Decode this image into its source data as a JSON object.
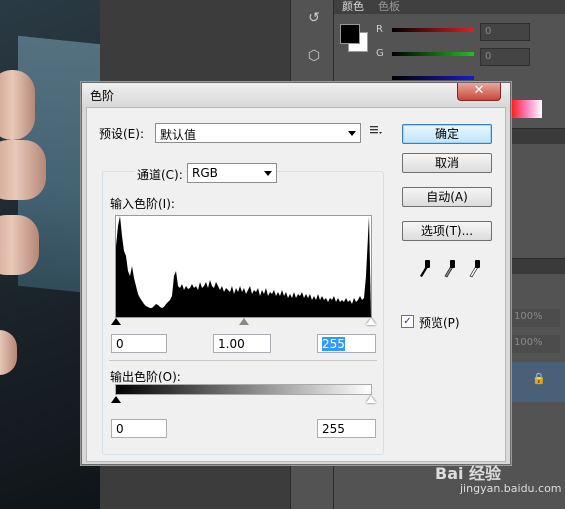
{
  "panel": {
    "tab_color": "颜色",
    "tab_swatches": "色板",
    "channels": [
      {
        "label": "R",
        "value": "0",
        "color": "#e02020"
      },
      {
        "label": "G",
        "value": "0",
        "color": "#20c020"
      },
      {
        "label": "B",
        "value": "",
        "color": "#1a1acc"
      }
    ],
    "zoom_values": [
      "100%",
      "100%"
    ]
  },
  "dialog": {
    "title": "色阶",
    "close_label": "✕",
    "preset_label": "预设(E):",
    "preset_value": "默认值",
    "channel_label": "通道(C):",
    "channel_value": "RGB",
    "input_levels_label": "输入色阶(I):",
    "input_black": "0",
    "input_gamma": "1.00",
    "input_white": "255",
    "output_levels_label": "输出色阶(O):",
    "output_black": "0",
    "output_white": "255",
    "buttons": {
      "ok": "确定",
      "cancel": "取消",
      "auto": "自动(A)",
      "options": "选项(T)..."
    },
    "preview_label": "预览(P)",
    "preview_checked": true,
    "preview_check_glyph": "✓"
  },
  "watermark": {
    "brand": "Bai 经验",
    "url": "jingyan.baidu.com"
  }
}
